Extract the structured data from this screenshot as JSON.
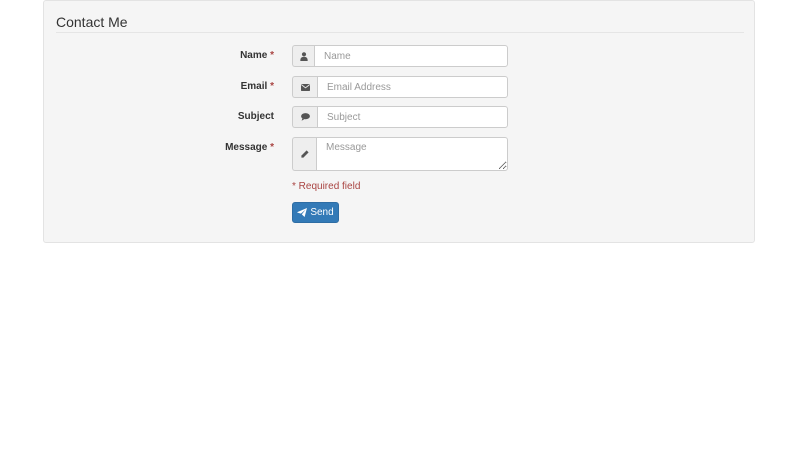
{
  "form": {
    "title": "Contact Me",
    "required_marker": "*",
    "fields": {
      "name": {
        "label": "Name",
        "placeholder": "Name",
        "icon": "user-icon"
      },
      "email": {
        "label": "Email",
        "placeholder": "Email Address",
        "icon": "envelope-icon"
      },
      "subject": {
        "label": "Subject",
        "placeholder": "Subject",
        "icon": "comment-icon"
      },
      "message": {
        "label": "Message",
        "placeholder": "Message",
        "icon": "pencil-icon"
      }
    },
    "required_note": "* Required field",
    "send_label": "Send",
    "send_icon": "send-icon"
  },
  "colors": {
    "primary": "#337ab7",
    "required": "#a94442",
    "well_bg": "#f5f5f5"
  }
}
